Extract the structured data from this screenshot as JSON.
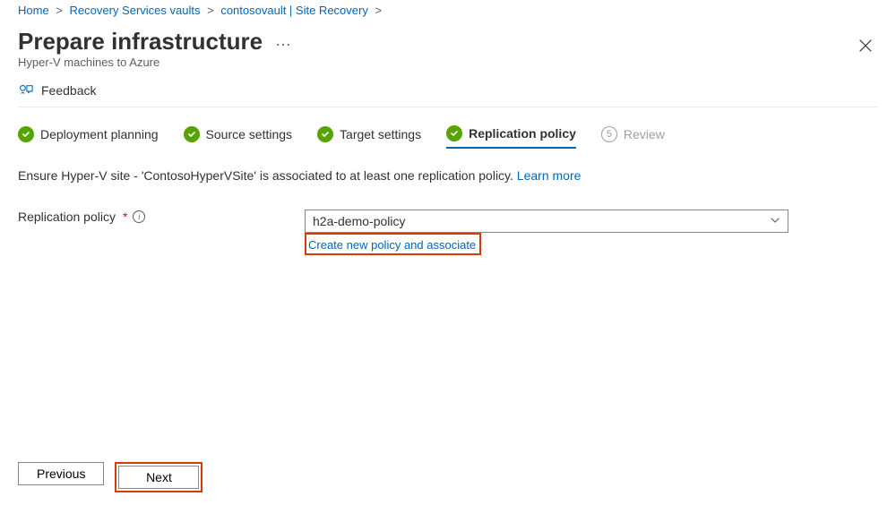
{
  "breadcrumb": {
    "items": [
      "Home",
      "Recovery Services vaults",
      "contosovault | Site Recovery"
    ]
  },
  "header": {
    "title": "Prepare infrastructure",
    "subtitle": "Hyper-V machines to Azure"
  },
  "toolbar": {
    "feedback": "Feedback"
  },
  "steps": [
    {
      "label": "Deployment planning",
      "state": "done"
    },
    {
      "label": "Source settings",
      "state": "done"
    },
    {
      "label": "Target settings",
      "state": "done"
    },
    {
      "label": "Replication policy",
      "state": "active"
    },
    {
      "label": "Review",
      "state": "pending",
      "num": "5"
    }
  ],
  "description": {
    "text": "Ensure Hyper-V site - 'ContosoHyperVSite' is associated to at least one replication policy. ",
    "learn_more": "Learn more"
  },
  "field": {
    "label": "Replication policy",
    "value": "h2a-demo-policy",
    "create_link": "Create new policy and associate"
  },
  "footer": {
    "previous": "Previous",
    "next": "Next"
  }
}
